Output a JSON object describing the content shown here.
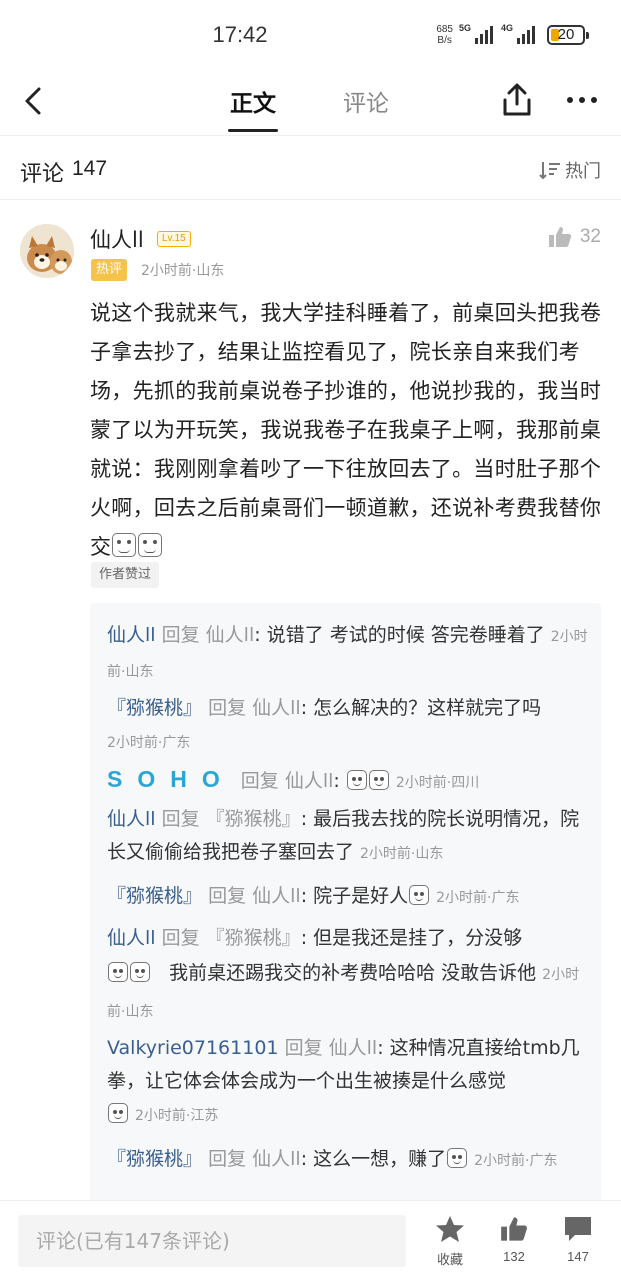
{
  "status_bar": {
    "time": "17:42",
    "net_speed_value": "685",
    "net_speed_unit": "B/s",
    "signal_1": "5G",
    "signal_2": "4G",
    "battery": "20"
  },
  "nav": {
    "tab_main": "正文",
    "tab_comment": "评论"
  },
  "comments_header": {
    "title": "评论",
    "count": "147",
    "sort_label": "热门"
  },
  "main_comment": {
    "user": "仙人ll",
    "level": "Lv.15",
    "likes": "32",
    "hot_badge": "热评",
    "meta": "2小时前·山东",
    "text": "说这个我就来气，我大学挂科睡着了，前桌回头把我卷子拿去抄了，结果让监控看见了，院长亲自来我们考场，先抓的我前桌说卷子抄谁的，他说抄我的，我当时蒙了以为开玩笑，我说我卷子在我桌子上啊，我那前桌就说：我刚刚拿着吵了一下往放回去了。当时肚子那个火啊，回去之后前桌哥们一顿道歉，还说补考费我替你交",
    "author_liked": "作者赞过"
  },
  "replies": [
    {
      "user": "仙人ll",
      "reply_word": "回复",
      "target": "仙人ll",
      "text": ": 说错了 考试的时候 答完卷睡着了",
      "time": "2小时前·山东"
    },
    {
      "user": "『猕猴桃』",
      "reply_word": "回复",
      "target": "仙人ll",
      "text": ": 怎么解决的？这样就完了吗",
      "time": "2小时前·广东"
    },
    {
      "user": "SOHO",
      "reply_word": "回复",
      "target": "仙人ll",
      "text": ":",
      "time": "2小时前·四川"
    },
    {
      "user": "仙人ll",
      "reply_word": "回复",
      "target": "『猕猴桃』",
      "text": ": 最后我去找的院长说明情况，院长又偷偷给我把卷子塞回去了",
      "time": "2小时前·山东"
    },
    {
      "user": "『猕猴桃』",
      "reply_word": "回复",
      "target": "仙人ll",
      "text": ": 院子是好人",
      "time": "2小时前·广东"
    },
    {
      "user": "仙人ll",
      "reply_word": "回复",
      "target": "『猕猴桃』",
      "text": ": 但是我还是挂了，分没够",
      "text2": "我前桌还踢我交的补考费哈哈哈  没敢告诉他",
      "time": "2小时前·山东"
    },
    {
      "user": "Valkyrie07161101",
      "reply_word": "回复",
      "target": "仙人ll",
      "text": ": 这种情况直接给tmb几拳，让它体会体会成为一个出生被揍是什么感觉",
      "time": "2小时前·江苏"
    },
    {
      "user": "『猕猴桃』",
      "reply_word": "回复",
      "target": "仙人ll",
      "text": ": 这么一想，赚了",
      "time": "2小时前·广东"
    }
  ],
  "bottom_bar": {
    "input_placeholder": "评论(已有147条评论)",
    "collect_label": "收藏",
    "like_count": "132",
    "comment_count": "147"
  },
  "colors": {
    "username_link": "#3a5f8f",
    "hot_badge": "#f5c24a",
    "level_badge": "#e3a000",
    "reply_bg": "#f7f8fa",
    "soho_logo": "#2aa6d6"
  }
}
